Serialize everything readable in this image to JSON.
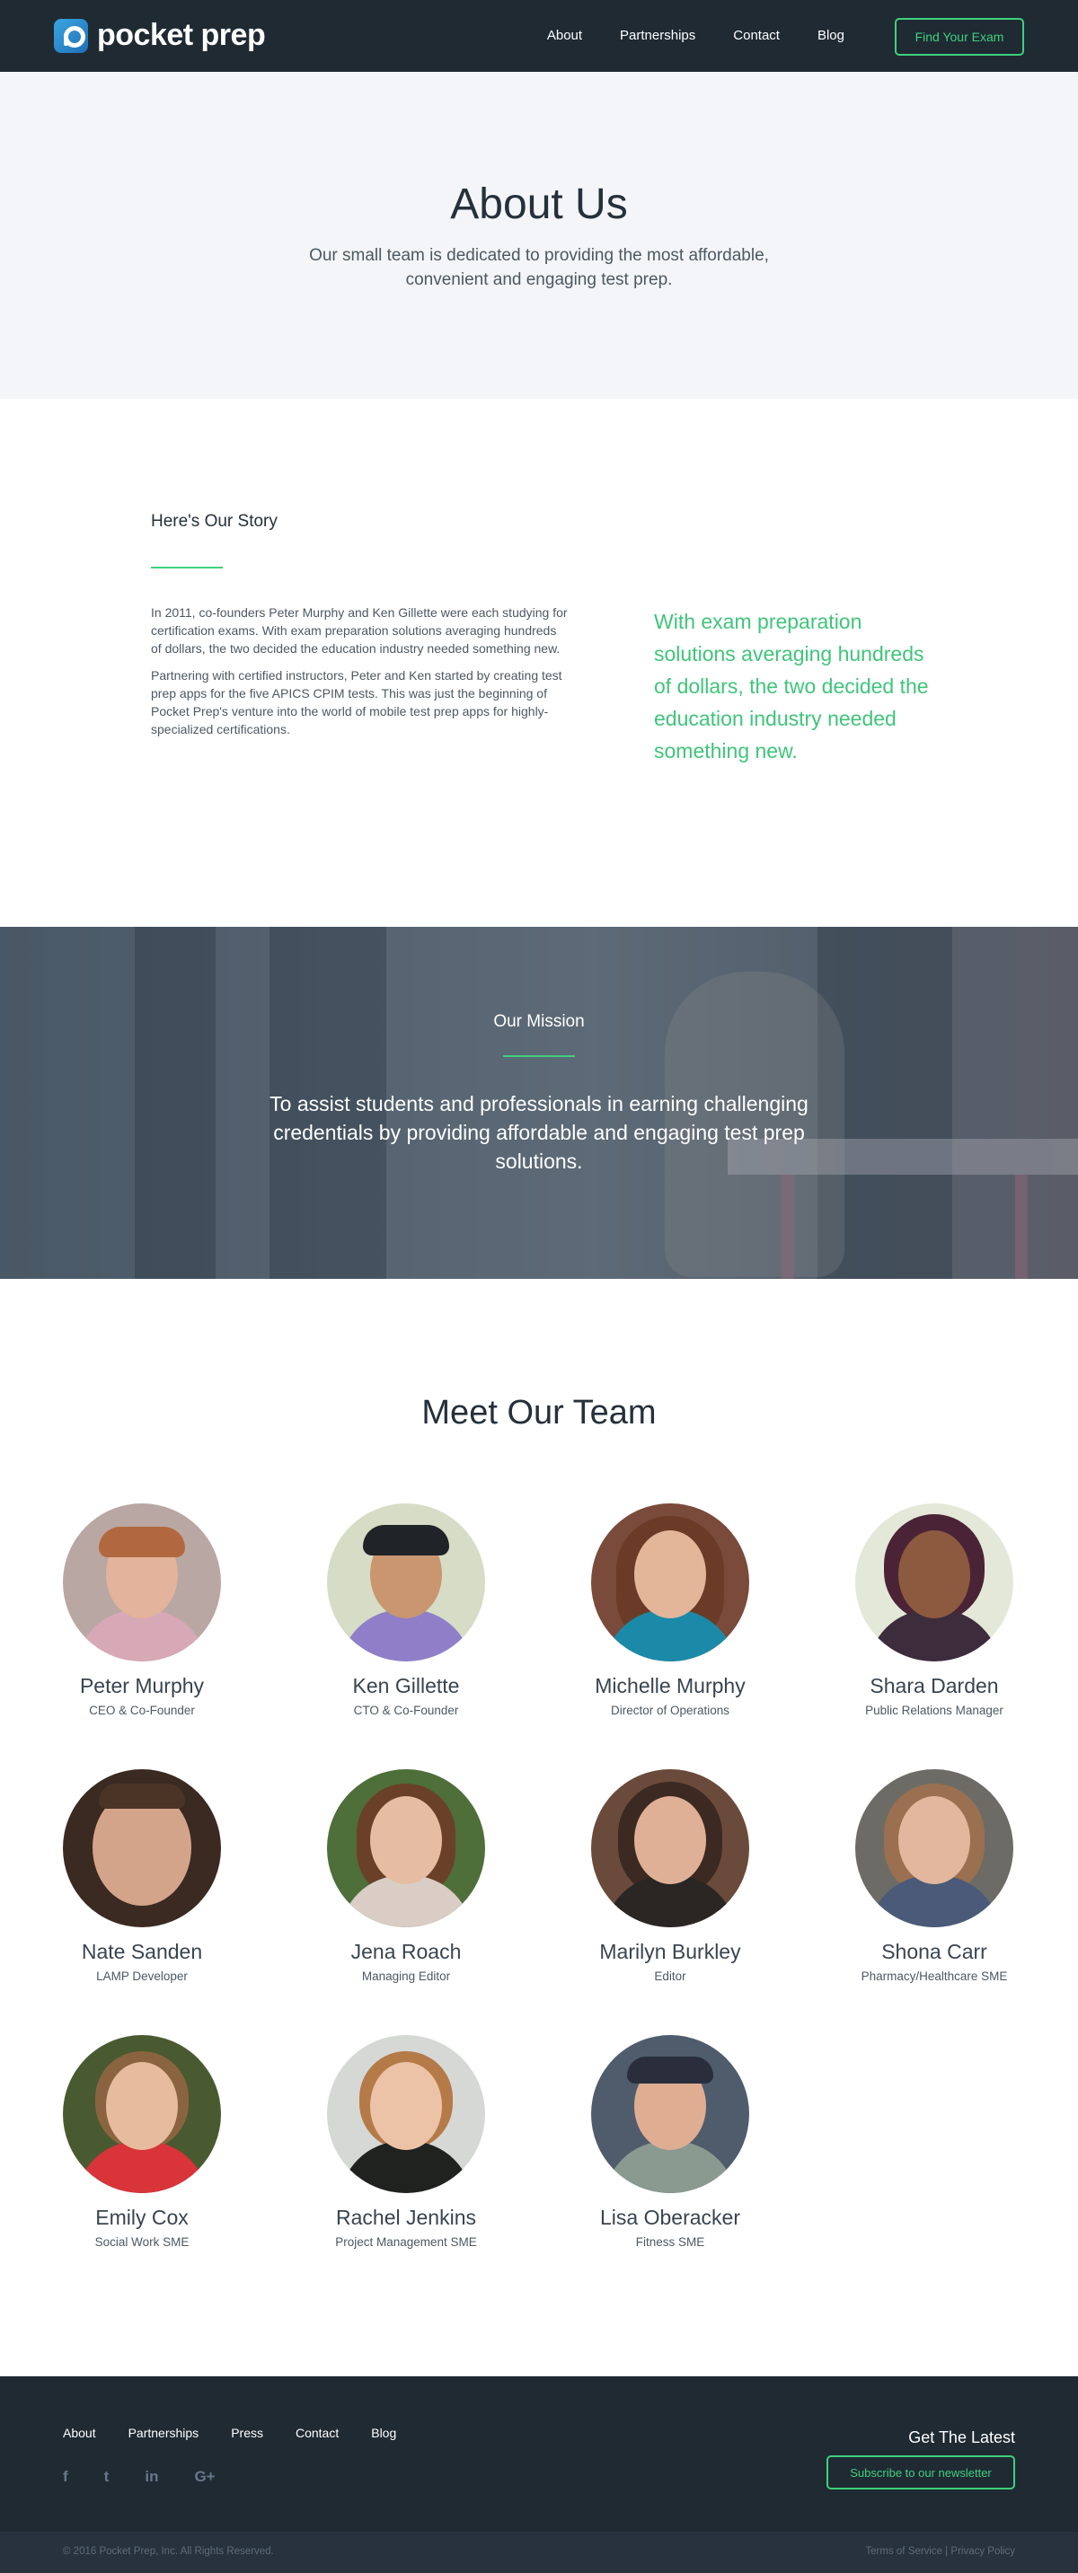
{
  "nav": {
    "brand": "pocket prep",
    "links": [
      "About",
      "Partnerships",
      "Contact",
      "Blog"
    ],
    "cta": "Find Your Exam"
  },
  "hero": {
    "title": "About Us",
    "subtitle": "Our small team is dedicated to providing the most affordable, convenient and engaging test prep."
  },
  "story": {
    "heading": "Here's Our Story",
    "paragraph1": "In 2011, co-founders Peter Murphy and Ken Gillette were each studying for certification exams. With exam preparation solutions averaging hundreds of dollars, the two decided the education industry needed something new.",
    "paragraph2": "Partnering with certified instructors, Peter and Ken started by creating test prep apps for the five APICS CPIM tests. This was just the beginning of Pocket Prep's venture into the world of mobile test prep apps for highly-specialized certifications.",
    "quote": "With exam preparation solutions averaging hundreds of dollars, the two decided the education industry needed something new."
  },
  "mission": {
    "heading": "Our Mission",
    "statement": "To assist students and professionals in earning challenging credentials by providing affordable and engaging test prep solutions."
  },
  "team": {
    "heading": "Meet Our Team",
    "members": [
      {
        "name": "Peter Murphy",
        "role": "CEO & Co-Founder"
      },
      {
        "name": "Ken Gillette",
        "role": "CTO & Co-Founder"
      },
      {
        "name": "Michelle Murphy",
        "role": "Director of Operations"
      },
      {
        "name": "Shara Darden",
        "role": "Public Relations Manager"
      },
      {
        "name": "Nate Sanden",
        "role": "LAMP Developer"
      },
      {
        "name": "Jena Roach",
        "role": "Managing Editor"
      },
      {
        "name": "Marilyn Burkley",
        "role": "Editor"
      },
      {
        "name": "Shona Carr",
        "role": "Pharmacy/Healthcare SME"
      },
      {
        "name": "Emily Cox",
        "role": "Social Work SME"
      },
      {
        "name": "Rachel Jenkins",
        "role": "Project Management SME"
      },
      {
        "name": "Lisa Oberacker",
        "role": "Fitness SME"
      }
    ]
  },
  "footer": {
    "links": [
      "About",
      "Partnerships",
      "Press",
      "Contact",
      "Blog"
    ],
    "social": [
      "f",
      "t",
      "in",
      "G+"
    ],
    "latest_heading": "Get The Latest",
    "newsletter": "Subscribe to our newsletter",
    "copyright": "© 2016 Pocket Prep, Inc. All Rights Reserved.",
    "legal": "Terms of Service | Privacy Policy"
  },
  "colors": {
    "accent": "#3fd07d",
    "dark": "#1f2a33"
  }
}
